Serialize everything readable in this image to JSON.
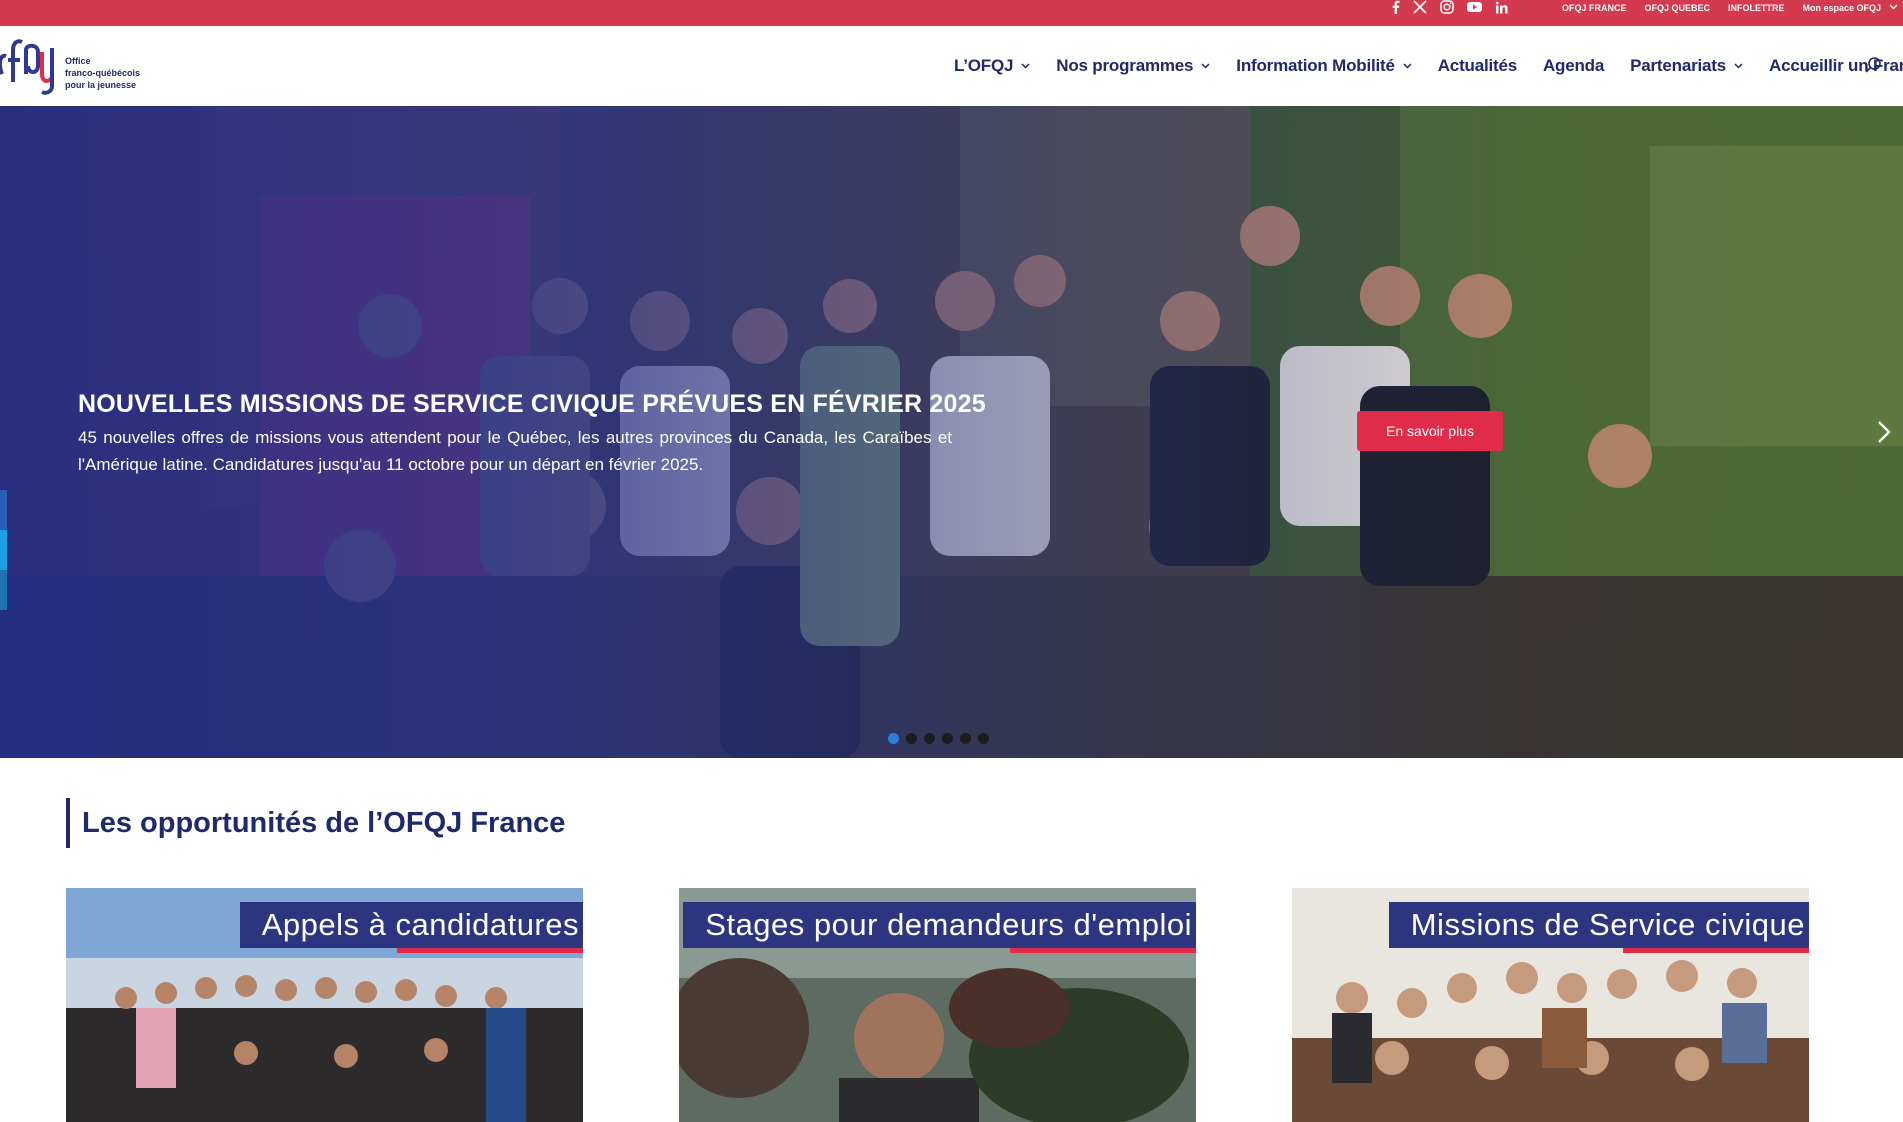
{
  "topbar": {
    "social_icons": [
      "facebook-icon",
      "x-icon",
      "instagram-icon",
      "youtube-icon",
      "linkedin-icon"
    ],
    "links": [
      "OFQJ FRANCE",
      "OFQJ QUEBEC",
      "INFOLETTRE",
      "Mon espace OFQJ"
    ]
  },
  "header": {
    "logo_text_1": "Office",
    "logo_text_2": "franco-québécois",
    "logo_text_3": "pour la jeunesse",
    "nav": [
      {
        "label": "L’OFQJ",
        "dropdown": true
      },
      {
        "label": "Nos programmes",
        "dropdown": true
      },
      {
        "label": "Information Mobilité",
        "dropdown": true
      },
      {
        "label": "Actualités",
        "dropdown": false
      },
      {
        "label": "Agenda",
        "dropdown": false
      },
      {
        "label": "Partenariats",
        "dropdown": true
      },
      {
        "label": "Accueillir un Français",
        "dropdown": true
      }
    ]
  },
  "hero": {
    "title": "NOUVELLES MISSIONS DE SERVICE CIVIQUE PRÉVUES EN FÉVRIER 2025",
    "text": "45 nouvelles offres de missions vous attendent pour le Québec, les autres provinces du Canada, les Caraïbes et l'Amérique latine. Candidatures jusqu'au 11 octobre pour un départ en février 2025.",
    "button": "En savoir plus",
    "slide_count": 6,
    "active_slide": 1
  },
  "opportunities": {
    "title": "Les opportunités de l’OFQJ France",
    "cards": [
      {
        "label": "Appels à candidatures"
      },
      {
        "label": "Stages pour demandeurs d'emploi"
      },
      {
        "label": "Missions de Service civique"
      }
    ]
  },
  "colors": {
    "topbar": "#d33a4f",
    "navy": "#1f2a6b",
    "accent_red": "#e02c4a",
    "active_dot": "#2b7fd8"
  }
}
